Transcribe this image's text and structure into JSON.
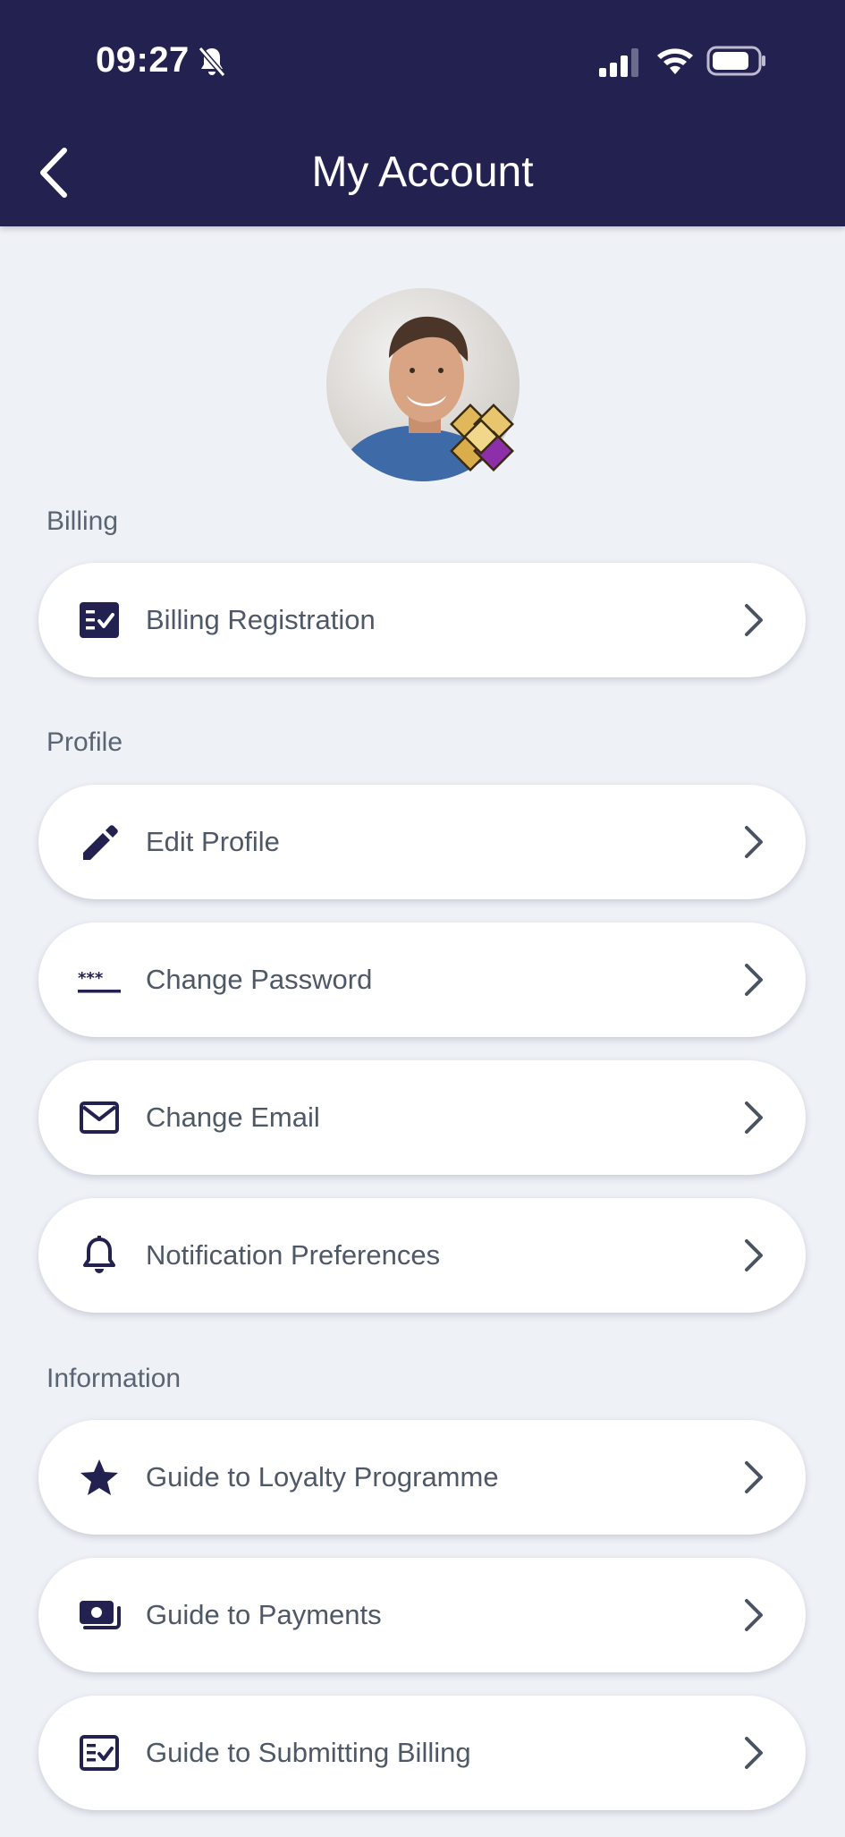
{
  "status_bar": {
    "time": "09:27"
  },
  "header": {
    "title": "My Account"
  },
  "colors": {
    "header_bg": "#232150",
    "icon": "#232150",
    "background": "#eef1f6"
  },
  "sections": [
    {
      "label": "Billing",
      "items": [
        {
          "label": "Billing Registration",
          "icon": "checklist-icon"
        }
      ]
    },
    {
      "label": "Profile",
      "items": [
        {
          "label": "Edit Profile",
          "icon": "pencil-icon"
        },
        {
          "label": "Change Password",
          "icon": "password-icon"
        },
        {
          "label": "Change Email",
          "icon": "envelope-icon"
        },
        {
          "label": "Notification Preferences",
          "icon": "bell-icon"
        }
      ]
    },
    {
      "label": "Information",
      "items": [
        {
          "label": "Guide to Loyalty Programme",
          "icon": "star-icon"
        },
        {
          "label": "Guide to Payments",
          "icon": "money-icon"
        },
        {
          "label": "Guide to Submitting Billing",
          "icon": "checklist-outline-icon"
        }
      ]
    }
  ]
}
